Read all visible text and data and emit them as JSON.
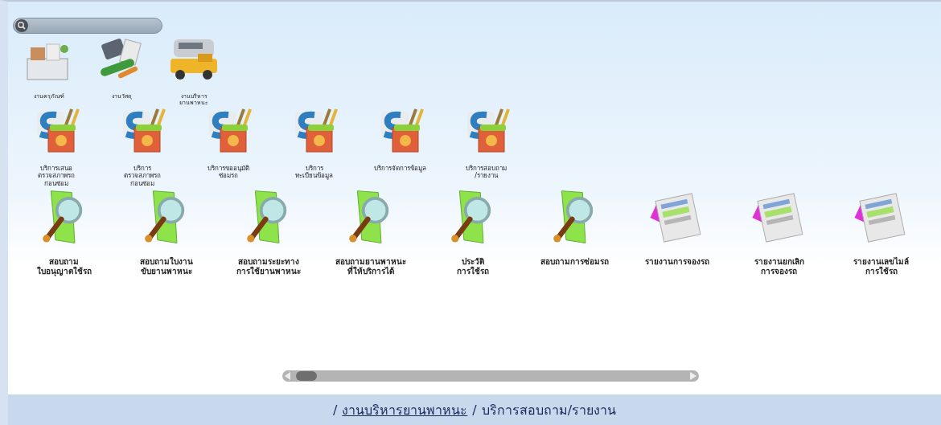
{
  "departments": [
    {
      "kind": "furniture",
      "label": "งานครุภัณฑ์"
    },
    {
      "kind": "supplies",
      "label": "งานวัสดุ"
    },
    {
      "kind": "vehicle",
      "label": "งานบริหาร\nยานพาหนะ"
    }
  ],
  "services": [
    {
      "label": "บริการเสนอ\nตรวจสภาพรถ\nก่อนซ่อม"
    },
    {
      "label": "บริการ\nตรวจสภาพรถ\nก่อนซ่อม"
    },
    {
      "label": "บริการขออนุมัติ\nซ่อมรถ"
    },
    {
      "label": "บริการ\nทะเบียนข้อมูล"
    },
    {
      "label": "บริการจัดการข้อมูล"
    },
    {
      "label": "บริการสอบถาม\n/รายงาน"
    }
  ],
  "reports": [
    {
      "kind": "inquiry",
      "label": "สอบถาม\nใบอนุญาตใช้รถ"
    },
    {
      "kind": "inquiry",
      "label": "สอบถามใบงาน\nขับยานพาหนะ"
    },
    {
      "kind": "inquiry",
      "label": "สอบถามระยะทาง\nการใช้ยานพาหนะ"
    },
    {
      "kind": "inquiry",
      "label": "สอบถามยานพาหนะ\nที่ให้บริการได้"
    },
    {
      "kind": "inquiry",
      "label": "ประวัติ\nการใช้รถ"
    },
    {
      "kind": "inquiry",
      "label": "สอบถามการซ่อมรถ"
    },
    {
      "kind": "report",
      "label": "รายงานการจองรถ"
    },
    {
      "kind": "report",
      "label": "รายงานยกเลิก\nการจองรถ"
    },
    {
      "kind": "report",
      "label": "รายงานเลขไมล์\nการใช้รถ"
    }
  ],
  "breadcrumb": {
    "separator": "/",
    "items": [
      {
        "label": "งานบริหารยานพาหนะ",
        "link": true
      },
      {
        "label": "บริการสอบถาม/รายงาน",
        "link": false
      }
    ]
  }
}
